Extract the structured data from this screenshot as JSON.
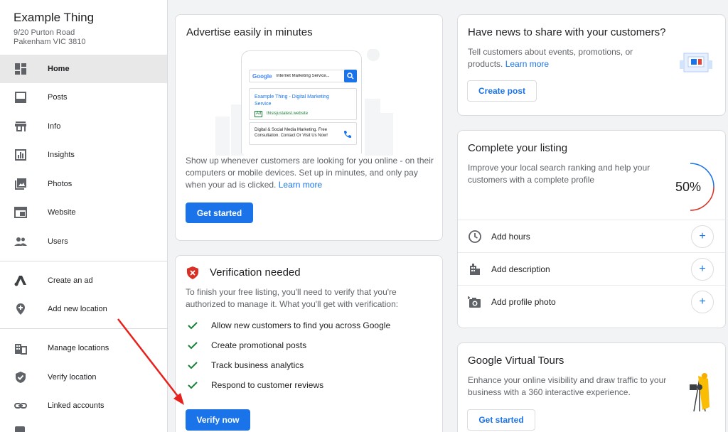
{
  "business": {
    "name": "Example Thing",
    "address_line1": "9/20 Purton Road",
    "address_line2": "Pakenham VIC 3810"
  },
  "sidebar": {
    "items": [
      {
        "label": "Home",
        "icon": "dashboard-icon",
        "active": true
      },
      {
        "label": "Posts",
        "icon": "posts-icon"
      },
      {
        "label": "Info",
        "icon": "storefront-icon"
      },
      {
        "label": "Insights",
        "icon": "bar-chart-icon"
      },
      {
        "label": "Photos",
        "icon": "photos-icon"
      },
      {
        "label": "Website",
        "icon": "website-icon"
      },
      {
        "label": "Users",
        "icon": "users-icon"
      },
      {
        "label": "Create an ad",
        "icon": "google-ads-icon"
      },
      {
        "label": "Add new location",
        "icon": "add-location-icon"
      },
      {
        "label": "Manage locations",
        "icon": "buildings-icon"
      },
      {
        "label": "Verify location",
        "icon": "shield-check-icon"
      },
      {
        "label": "Linked accounts",
        "icon": "link-icon"
      }
    ]
  },
  "advertise_card": {
    "title": "Advertise easily in minutes",
    "illustration": {
      "search_logo": "Google",
      "search_query": "Internet Marketing Service...",
      "ad_title": "Example Thing - Digital Marketing Service",
      "ad_badge": "Ad",
      "ad_url": "thisisjustatest.website",
      "ad_description": "Digital & Social Media Marketing. Free Consultation. Contact Or Visit Us Now!"
    },
    "body": "Show up whenever customers are looking for you online - on their computers or mobile devices. Set up in minutes, and only pay when your ad is clicked.",
    "link": "Learn more",
    "button": "Get started"
  },
  "verification_card": {
    "title": "Verification needed",
    "body": "To finish your free listing, you'll need to verify that you're authorized to manage it. What you'll get with verification:",
    "benefits": [
      "Allow new customers to find you across Google",
      "Create promotional posts",
      "Track business analytics",
      "Respond to customer reviews"
    ],
    "button": "Verify now"
  },
  "news_card": {
    "title": "Have news to share with your customers?",
    "body": "Tell customers about events, promotions, or products.",
    "link": "Learn more",
    "button": "Create post"
  },
  "listing_card": {
    "title": "Complete your listing",
    "body": "Improve your local search ranking and help your customers with a complete profile",
    "progress_text": "50%",
    "progress_value": 0.5,
    "rows": [
      {
        "label": "Add hours",
        "icon": "clock-icon"
      },
      {
        "label": "Add description",
        "icon": "store-icon"
      },
      {
        "label": "Add profile photo",
        "icon": "add-photo-icon"
      }
    ]
  },
  "tours_card": {
    "title": "Google Virtual Tours",
    "body": "Enhance your online visibility and draw traffic to your business with a 360 interactive experience.",
    "button": "Get started"
  },
  "colors": {
    "accent": "#1a73e8",
    "success": "#188038",
    "error": "#d93025",
    "annotation_arrow": "#e8211c"
  }
}
